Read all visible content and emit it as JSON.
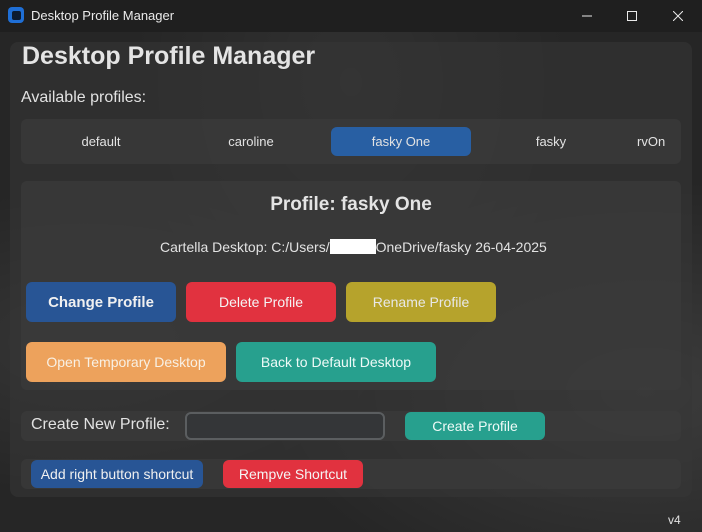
{
  "window": {
    "title": "Desktop Profile Manager",
    "controls": {
      "minimize": "minimize-icon",
      "maximize": "maximize-icon",
      "close": "close-icon"
    }
  },
  "app": {
    "title": "Desktop Profile Manager",
    "available_label": "Available profiles:"
  },
  "profiles": {
    "tabs": [
      {
        "label": "default",
        "selected": false
      },
      {
        "label": "caroline",
        "selected": false
      },
      {
        "label": "fasky One",
        "selected": true
      },
      {
        "label": "fasky",
        "selected": false
      }
    ],
    "overflow_tab_visible_text": "rvOn"
  },
  "profile_panel": {
    "heading": "Profile: fasky One",
    "path_prefix": "Cartella Desktop: C:/Users/",
    "path_suffix": "OneDrive/fasky 26-04-2025"
  },
  "actions": {
    "change": "Change Profile",
    "delete": "Delete Profile",
    "rename": "Rename Profile",
    "temporary": "Open Temporary Desktop",
    "back_default": "Back to Default Desktop"
  },
  "create": {
    "label": "Create New Profile:",
    "input_value": "",
    "input_placeholder": "",
    "button": "Create Profile"
  },
  "shortcuts": {
    "add": "Add right button shortcut",
    "remove": "Rempve Shortcut"
  },
  "version": "v4",
  "colors": {
    "accent_blue": "#285595",
    "selected_tab": "#285fa3",
    "red": "#e1323f",
    "olive": "#b6a32c",
    "orange": "#eda25c",
    "teal": "#27a08e"
  }
}
